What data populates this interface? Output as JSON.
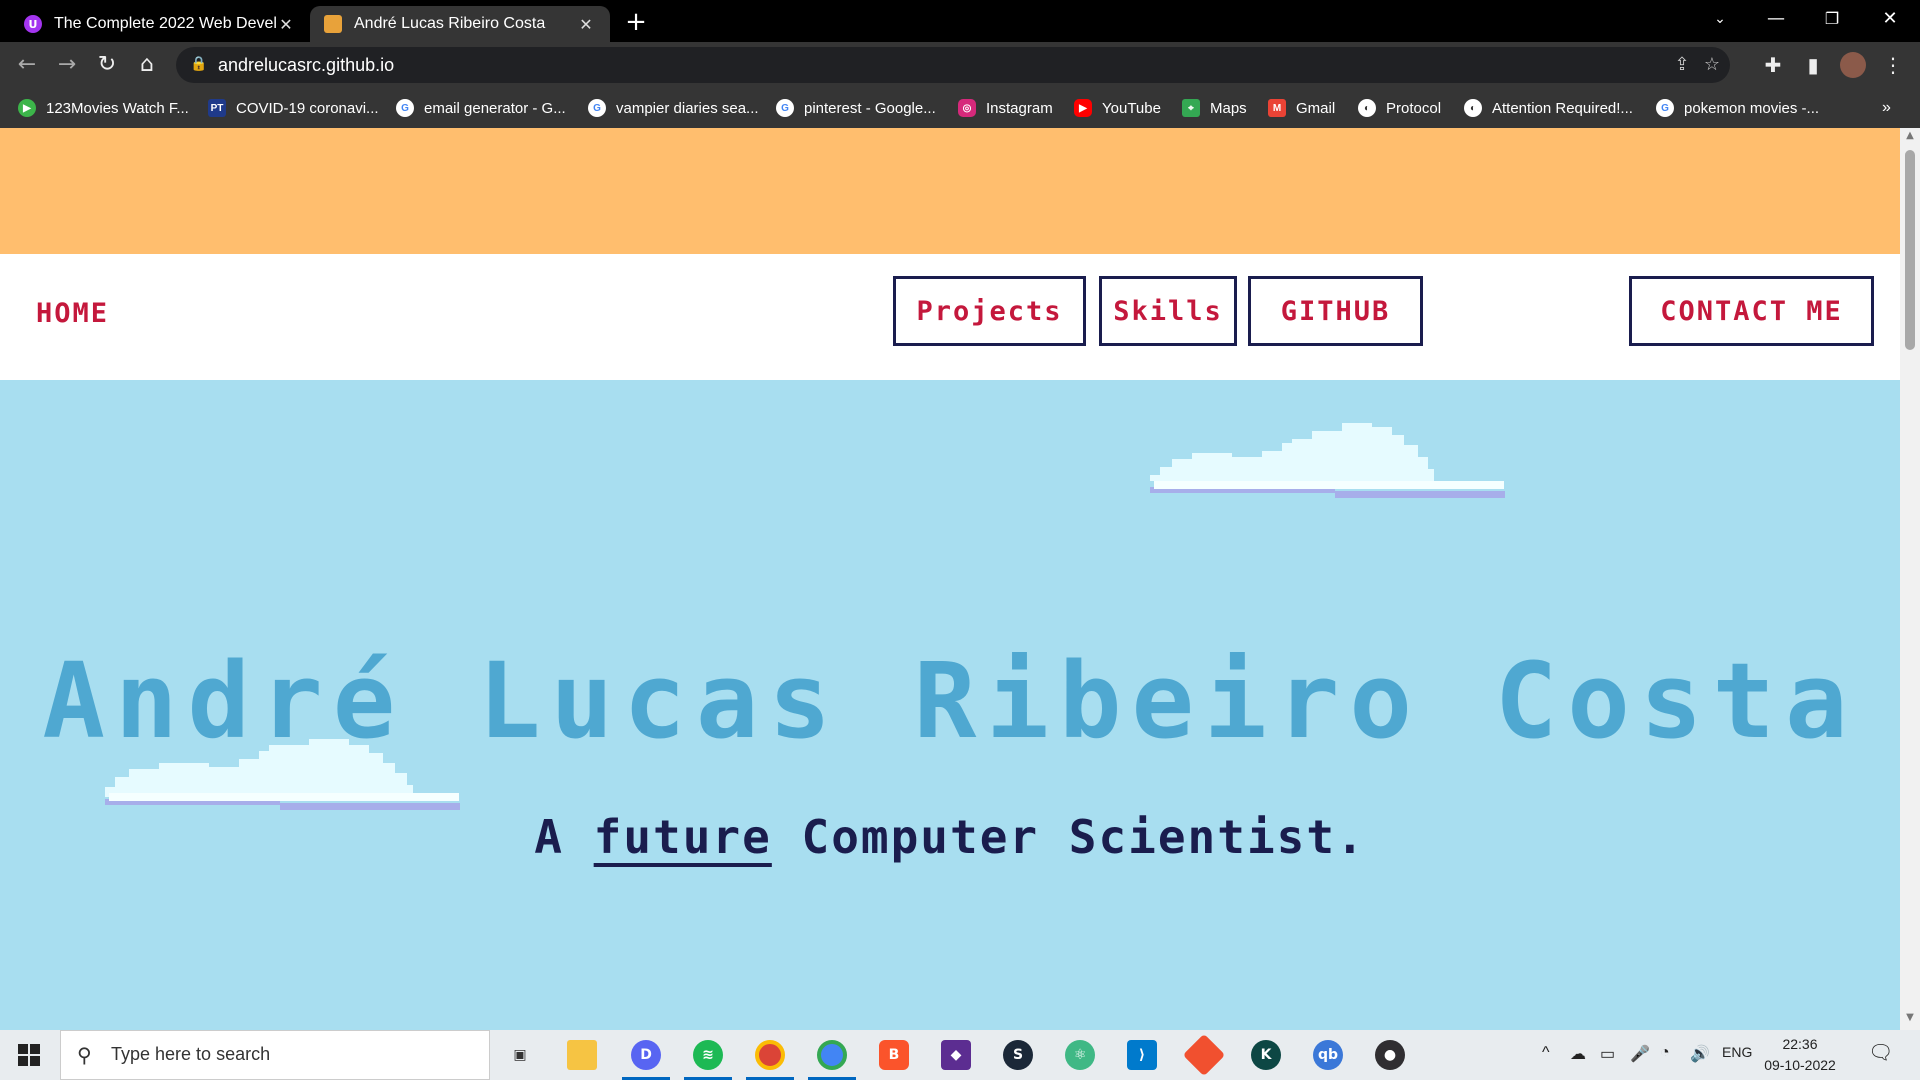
{
  "tabs": [
    {
      "title": "The Complete 2022 Web Develop",
      "favicon_letter": "U"
    },
    {
      "title": "André Lucas Ribeiro Costa"
    }
  ],
  "address_bar": {
    "url": "andrelucasrc.github.io"
  },
  "bookmarks": [
    {
      "label": "123Movies Watch F...",
      "icon": "play-icon",
      "color": "#3cb54a"
    },
    {
      "label": "COVID-19 coronavi...",
      "icon": "pt-icon",
      "color": "#1f3a8a",
      "text": "PT"
    },
    {
      "label": "email generator - G...",
      "icon": "google-icon",
      "color": "#ffffff"
    },
    {
      "label": "vampier diaries sea...",
      "icon": "google-icon",
      "color": "#ffffff"
    },
    {
      "label": "pinterest - Google...",
      "icon": "google-icon",
      "color": "#ffffff"
    },
    {
      "label": "Instagram",
      "icon": "instagram-icon",
      "color": "#d6297b"
    },
    {
      "label": "YouTube",
      "icon": "youtube-icon",
      "color": "#ff0000"
    },
    {
      "label": "Maps",
      "icon": "maps-icon",
      "color": "#34a853"
    },
    {
      "label": "Gmail",
      "icon": "gmail-icon",
      "color": "#ea4335"
    },
    {
      "label": "Protocol",
      "icon": "globe-icon",
      "color": "#ffffff"
    },
    {
      "label": "Attention Required!...",
      "icon": "globe-icon",
      "color": "#ffffff"
    },
    {
      "label": "pokemon movies -...",
      "icon": "google-icon",
      "color": "#ffffff"
    }
  ],
  "page": {
    "nav": {
      "home": "HOME",
      "projects": "Projects",
      "skills": "Skills",
      "github": "GITHUB",
      "contact": "CONTACT ME"
    },
    "hero_title": "André Lucas Ribeiro Costa",
    "subtitle_prefix": "A ",
    "subtitle_link": "future",
    "subtitle_suffix": " Computer Scientist."
  },
  "colors": {
    "banner": "#ffbe6e",
    "sky": "#a8def0",
    "nav_text": "#c4183c",
    "nav_border": "#1a1d4e",
    "title": "#4fa8d1"
  },
  "taskbar": {
    "search_placeholder": "Type here to search",
    "language": "ENG",
    "time": "22:36",
    "date": "09-10-2022"
  }
}
